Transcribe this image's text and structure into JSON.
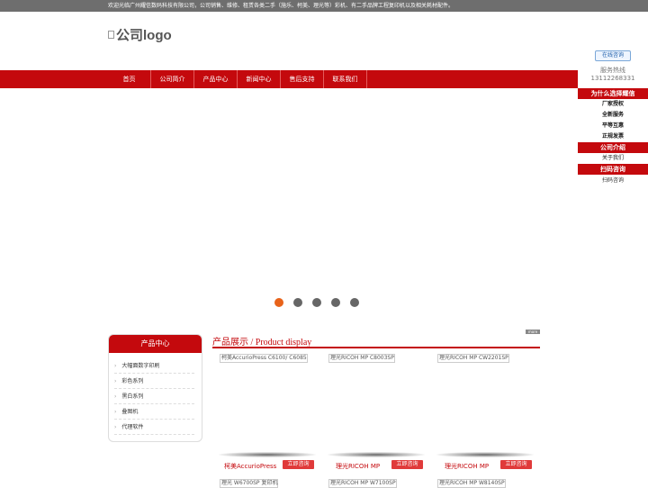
{
  "topbar": {
    "text": "欢迎光临广州耀信数码科技有限公司，公司销售、维修、租赁各类二手（施乐、柯美、理光等）彩机、有二手品牌工程复印机以及相关耗材配件。"
  },
  "logo": {
    "alt": "公司logo"
  },
  "nav": [
    "首页",
    "公司简介",
    "产品中心",
    "新闻中心",
    "售后支持",
    "联系我们"
  ],
  "banner": {
    "slide_count": 5,
    "active_index": 0
  },
  "side": {
    "consult_label": "在线咨询",
    "hotline_label": "服务热线",
    "hotline_number": "13112268331",
    "why_title": "为什么选择耀信",
    "why_items": [
      "厂家授权",
      "全新服务",
      "平等互惠",
      "正规发票"
    ],
    "about_title": "公司介绍",
    "about_item": "关于我们",
    "qr_title": "扫码咨询",
    "qr_alt": "扫码咨询"
  },
  "category": {
    "title": "产品中心",
    "items": [
      "大幅面数字印刷",
      "彩色系列",
      "黑白系列",
      "叠图机",
      "代理软件"
    ]
  },
  "products": {
    "title": "产品展示 / Product display",
    "more": "more",
    "button_label": "立即咨询",
    "row1": [
      {
        "img_alt": "柯美AccurioPress C6100/ C6085",
        "name": "柯美AccurioPress"
      },
      {
        "img_alt": "理光RICOH MP C8003SP",
        "name": "理光RICOH MP"
      },
      {
        "img_alt": "理光RICOH MP CW2201SP",
        "name": "理光RICOH MP"
      }
    ],
    "row2": [
      {
        "img_alt": "理光 W6700SP 复印机"
      },
      {
        "img_alt": "理光RICOH MP W7100SP"
      },
      {
        "img_alt": "理光RICOH MP W8140SP"
      }
    ]
  }
}
